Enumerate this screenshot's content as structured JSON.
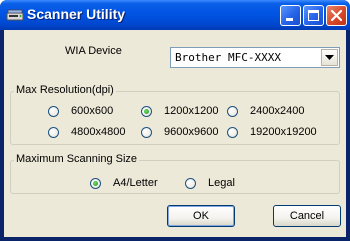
{
  "window": {
    "title": "Scanner Utility",
    "titlebar_color": "#0054e3",
    "close_color": "#d9482a"
  },
  "wia": {
    "label": "WIA Device",
    "selected": "Brother MFC-XXXX"
  },
  "resolution": {
    "title": "Max Resolution(dpi)",
    "options": [
      "600x600",
      "1200x1200",
      "2400x2400",
      "4800x4800",
      "9600x9600",
      "19200x19200"
    ],
    "selected": "1200x1200"
  },
  "size": {
    "title": "Maximum Scanning Size",
    "options": [
      "A4/Letter",
      "Legal"
    ],
    "selected": "A4/Letter"
  },
  "buttons": {
    "ok": "OK",
    "cancel": "Cancel"
  }
}
